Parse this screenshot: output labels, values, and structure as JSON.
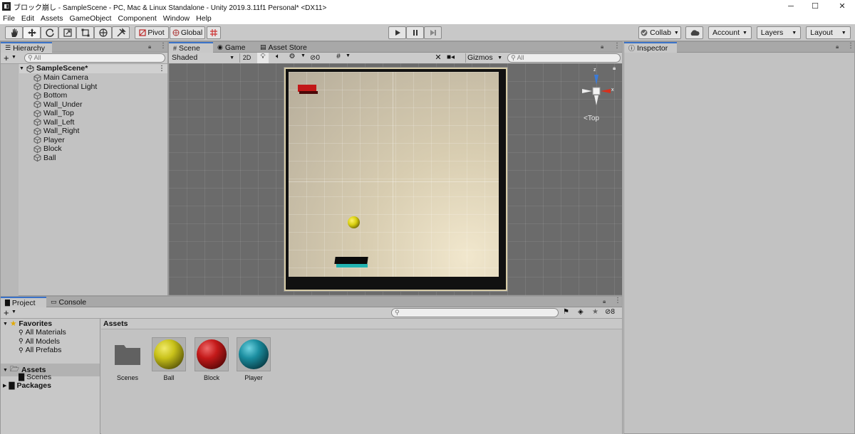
{
  "window": {
    "title": "ブロック崩し - SampleScene - PC, Mac & Linux Standalone - Unity 2019.3.11f1 Personal* <DX11>",
    "minimize": "─",
    "maximize": "☐",
    "close": "✕"
  },
  "menu": [
    "File",
    "Edit",
    "Assets",
    "GameObject",
    "Component",
    "Window",
    "Help"
  ],
  "toolbar": {
    "tools": [
      "hand-icon",
      "move-icon",
      "rotate-icon",
      "scale-icon",
      "rect-icon",
      "transform-icon",
      "custom-tool-icon"
    ],
    "pivot": "Pivot",
    "global": "Global",
    "collab": "Collab",
    "account": "Account",
    "layers": "Layers",
    "layout": "Layout"
  },
  "hierarchy": {
    "tab": "Hierarchy",
    "add": "+",
    "search_placeholder": "All",
    "scene": "SampleScene*",
    "items": [
      "Main Camera",
      "Directional Light",
      "Bottom",
      "Wall_Under",
      "Wall_Top",
      "Wall_Left",
      "Wall_Right",
      "Player",
      "Block",
      "Ball"
    ]
  },
  "scene": {
    "tabs": [
      "Scene",
      "Game",
      "Asset Store"
    ],
    "shading": "Shaded",
    "mode2d": "2D",
    "hidden_count": "0",
    "gizmos": "Gizmos",
    "search_placeholder": "All",
    "view_label": "Top",
    "axis_x": "x",
    "axis_z": "z"
  },
  "inspector": {
    "tab": "Inspector"
  },
  "project": {
    "tabs": [
      "Project",
      "Console"
    ],
    "add": "+",
    "count": "8",
    "favorites": "Favorites",
    "favorite_items": [
      "All Materials",
      "All Models",
      "All Prefabs"
    ],
    "assets_root": "Assets",
    "assets_children": [
      "Scenes"
    ],
    "packages": "Packages",
    "breadcrumb": "Assets",
    "assets": [
      {
        "name": "Scenes",
        "kind": "folder"
      },
      {
        "name": "Ball",
        "kind": "material",
        "color": "#c9c21a"
      },
      {
        "name": "Block",
        "kind": "material",
        "color": "#c41a1a"
      },
      {
        "name": "Player",
        "kind": "material",
        "color": "#1b8ea0"
      }
    ]
  },
  "colors": {
    "accent": "#3a72c8",
    "ball": "#d8cf10",
    "block": "#c21818",
    "player": "#22b3b0"
  }
}
